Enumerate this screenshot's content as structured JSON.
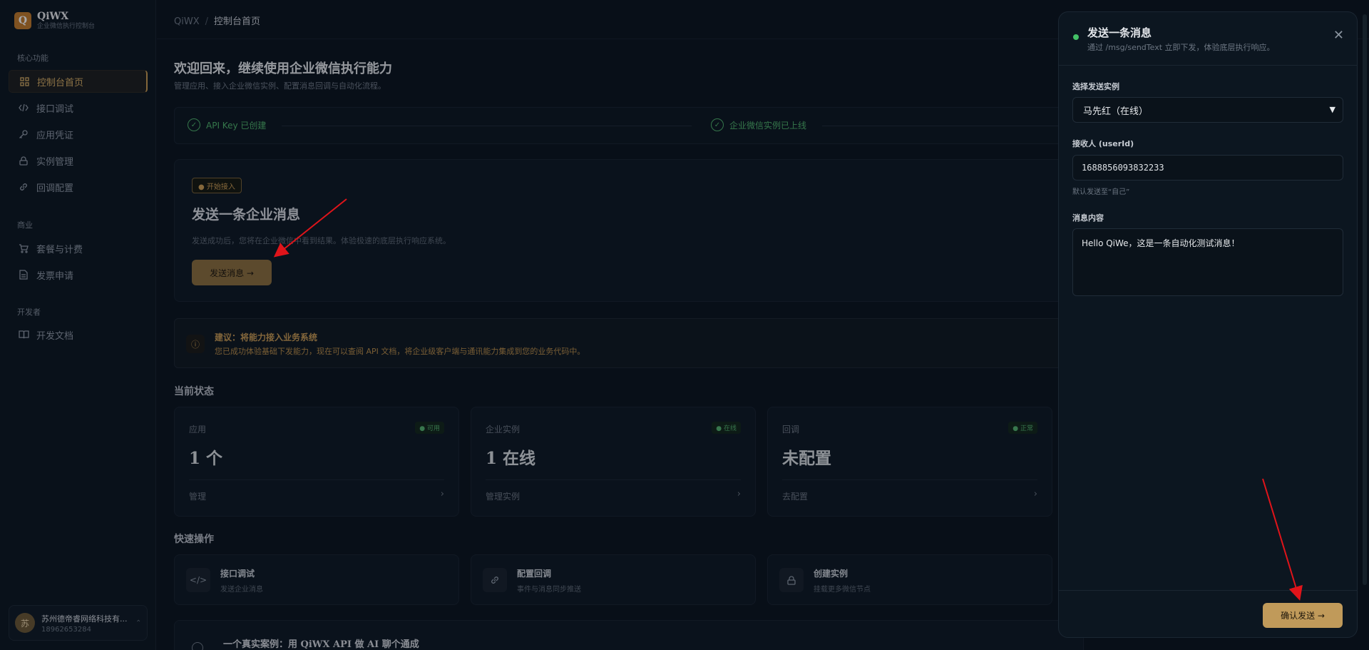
{
  "brand": {
    "logo_letter": "Q",
    "name": "QiWX",
    "subtitle": "企业微信执行控制台"
  },
  "sidebar": {
    "sections": [
      {
        "label": "核心功能"
      },
      {
        "label": "商业"
      },
      {
        "label": "开发者"
      }
    ],
    "items": [
      {
        "label": "控制台首页",
        "icon": "grid-icon",
        "active": true
      },
      {
        "label": "接口调试",
        "icon": "code-icon"
      },
      {
        "label": "应用凭证",
        "icon": "key-icon"
      },
      {
        "label": "实例管理",
        "icon": "lock-icon"
      },
      {
        "label": "回调配置",
        "icon": "link-icon"
      },
      {
        "label": "套餐与计费",
        "icon": "cart-icon"
      },
      {
        "label": "发票申请",
        "icon": "document-icon"
      },
      {
        "label": "开发文档",
        "icon": "book-icon"
      }
    ],
    "user": {
      "avatar": "苏",
      "name": "苏州德帝睿网络科技有...",
      "phone": "18962653284"
    }
  },
  "breadcrumb": {
    "root": "QiWX",
    "separator": "/",
    "current": "控制台首页"
  },
  "welcome": {
    "title": "欢迎回来，继续使用企业微信执行能力",
    "subtitle": "管理应用、接入企业微信实例、配置消息回调与自动化流程。"
  },
  "steps": [
    {
      "label": "API Key 已创建"
    },
    {
      "label": "企业微信实例已上线"
    }
  ],
  "hero": {
    "badge": "● 开始接入",
    "title": "发送一条企业消息",
    "desc": "发送成功后，您将在企业微信中看到结果。体验极速的底层执行响应系统。",
    "button": "发送消息 →"
  },
  "tip": {
    "title": "建议：将能力接入业务系统",
    "desc": "您已成功体验基础下发能力，现在可以查阅 API 文档，将企业级客户端与通讯能力集成到您的业务代码中。"
  },
  "status": {
    "title": "当前状态",
    "cards": [
      {
        "label": "应用",
        "badge": "● 可用",
        "value": "1 个",
        "link": "管理"
      },
      {
        "label": "企业实例",
        "badge": "● 在线",
        "value": "1 在线",
        "link": "管理实例"
      },
      {
        "label": "回调",
        "badge": "● 正常",
        "value": "未配置",
        "link": "去配置"
      }
    ]
  },
  "quick": {
    "title": "快速操作",
    "cards": [
      {
        "title": "接口调试",
        "desc": "发送企业消息",
        "icon": "code-icon"
      },
      {
        "title": "配置回调",
        "desc": "事件与消息同步推送",
        "icon": "link-icon"
      },
      {
        "title": "创建实例",
        "desc": "挂载更多微信节点",
        "icon": "lock-icon"
      }
    ]
  },
  "case": {
    "title": "一个真实案例：用 QiWX API 做 AI 聊个通成"
  },
  "drawer": {
    "title": "发送一条消息",
    "subtitle": "通过 /msg/sendText 立即下发，体验底层执行响应。",
    "instance_label": "选择发送实例",
    "instance_value": "马先红（在线）",
    "receiver_label": "接收人 (userId)",
    "receiver_value": "1688856093832233",
    "receiver_hint": "默认发送至“自己”",
    "content_label": "消息内容",
    "content_value": "Hello QiWe，这是一条自动化测试消息！",
    "confirm": "确认发送 →"
  },
  "colors": {
    "accent": "#c09a5a",
    "online": "#43c066",
    "bg": "#0a131d"
  }
}
